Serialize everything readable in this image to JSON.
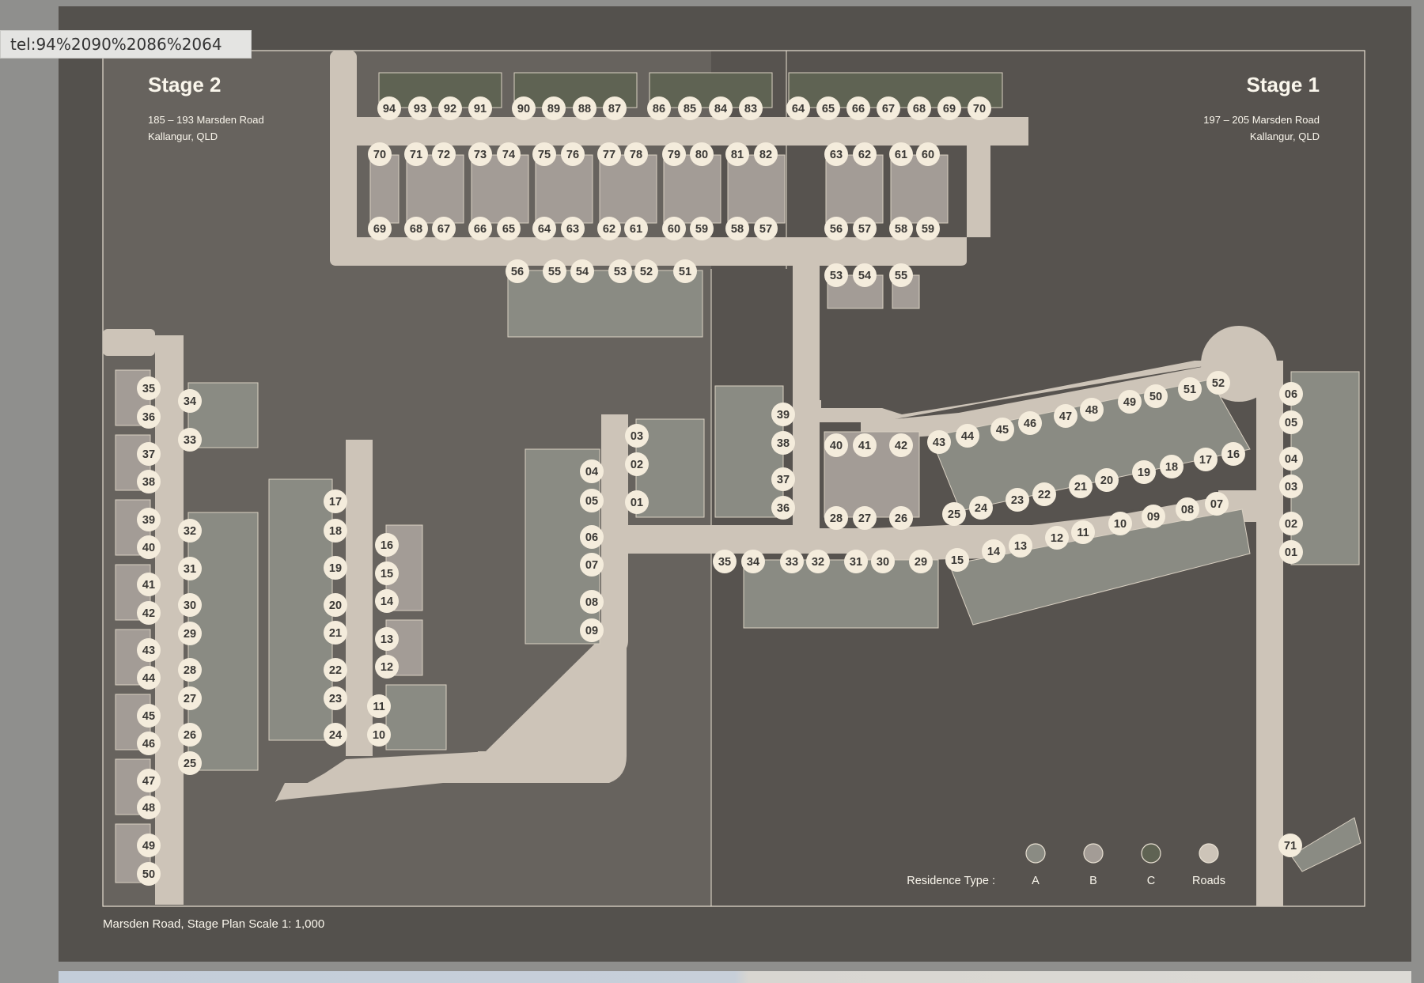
{
  "status_url": "tel:94%2090%2086%2064",
  "stage2": {
    "title": "Stage 2",
    "address_line1": "185 – 193 Marsden Road",
    "address_line2": "Kallangur, QLD"
  },
  "stage1": {
    "title": "Stage 1",
    "address_line1": "197 – 205 Marsden Road",
    "address_line2": "Kallangur, QLD"
  },
  "footer": {
    "caption": "Marsden Road, Stage Plan Scale 1: 1,000"
  },
  "legend": {
    "title": "Residence Type :",
    "items": [
      {
        "label": "A",
        "color": "#8a8b83"
      },
      {
        "label": "B",
        "color": "#a39c96"
      },
      {
        "label": "C",
        "color": "#5f6353"
      },
      {
        "label": "Roads",
        "color": "#cdc4b8"
      }
    ]
  },
  "colors": {
    "type_a": "#8a8b83",
    "type_b": "#a39c96",
    "type_c": "#5f6353",
    "road": "#cdc4b8",
    "badge": "#f4ecdc",
    "stage2_bg": "#67635e",
    "stage1_bg": "#57534f"
  },
  "lots": {
    "stage2_top_row": [
      "94",
      "93",
      "92",
      "91",
      "90",
      "89",
      "88",
      "87",
      "86",
      "85",
      "84",
      "83"
    ],
    "stage1_top_row": [
      "64",
      "65",
      "66",
      "67",
      "68",
      "69",
      "70"
    ],
    "stage2_mid_upper": [
      "70",
      "71",
      "72",
      "73",
      "74",
      "75",
      "76",
      "77",
      "78",
      "79",
      "80",
      "81",
      "82"
    ],
    "stage2_mid_lower": [
      "69",
      "68",
      "67",
      "66",
      "65",
      "64",
      "63",
      "62",
      "61",
      "60",
      "59",
      "58",
      "57"
    ],
    "stage1_mid_upper": [
      "63",
      "62",
      "61",
      "60"
    ],
    "stage1_mid_lower": [
      "56",
      "57",
      "58",
      "59"
    ],
    "stage2_below_road": [
      "56",
      "55",
      "54",
      "53",
      "52",
      "51"
    ],
    "stage1_below_road": [
      "53",
      "54",
      "55"
    ],
    "stage2_west_column": [
      "35",
      "36",
      "37",
      "38",
      "39",
      "40",
      "41",
      "42",
      "43",
      "44",
      "45",
      "46",
      "47",
      "48",
      "49",
      "50"
    ],
    "stage2_second_column": [
      "34",
      "33",
      "32",
      "31",
      "30",
      "29",
      "28",
      "27",
      "26",
      "25"
    ],
    "stage2_third_column": [
      "17",
      "18",
      "19",
      "20",
      "21",
      "22",
      "23",
      "24"
    ],
    "stage2_fourth_column": [
      "16",
      "15",
      "14",
      "13",
      "12",
      "11",
      "10"
    ],
    "stage2_center_cluster": [
      "04",
      "05",
      "06",
      "07",
      "08",
      "09",
      "03",
      "02",
      "01"
    ],
    "stage1_cluster_west": [
      "39",
      "38",
      "37",
      "36"
    ],
    "stage1_cluster_mid_upper": [
      "40",
      "41",
      "42"
    ],
    "stage1_cluster_mid_lower": [
      "28",
      "27",
      "26"
    ],
    "stage1_diagonal_upper": [
      "43",
      "44",
      "45",
      "46",
      "47",
      "48",
      "49",
      "50",
      "51",
      "52"
    ],
    "stage1_diagonal_lower": [
      "25",
      "24",
      "23",
      "22",
      "21",
      "20",
      "19",
      "18",
      "17",
      "16"
    ],
    "stage1_south_row": [
      "35",
      "34",
      "33",
      "32",
      "31",
      "30",
      "29",
      "15",
      "14",
      "13",
      "12",
      "11",
      "10",
      "09",
      "08",
      "07"
    ],
    "stage1_east_column": [
      "06",
      "05",
      "04",
      "03",
      "02",
      "01"
    ],
    "stage1_corner": [
      "71"
    ]
  }
}
